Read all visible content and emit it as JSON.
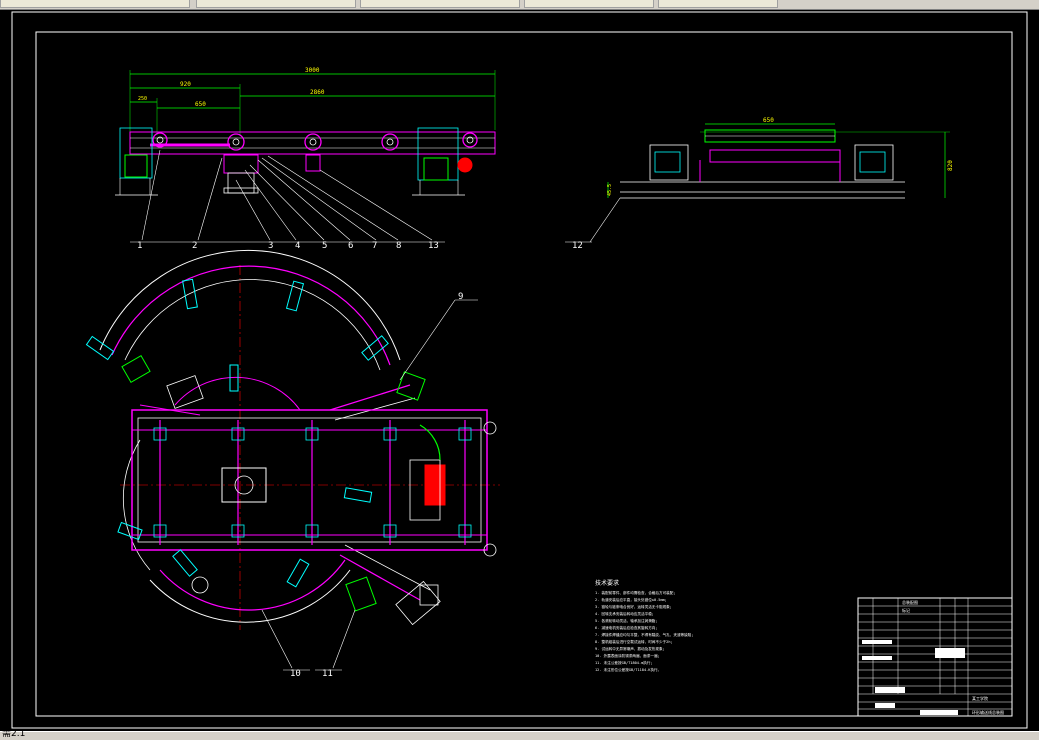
{
  "app": {
    "title": "AutoCAD drawing view"
  },
  "colors": {
    "background": "#000000",
    "frame": "#ffffff",
    "magenta": "#ff00ff",
    "green": "#00ff00",
    "cyan": "#00ffff",
    "red": "#ff0000",
    "yellow": "#ffff00",
    "white": "#ffffff"
  },
  "status": {
    "text": "需2.1"
  },
  "side_view": {
    "dimensions": [
      "3000",
      "920",
      "2860",
      "650",
      "250"
    ],
    "balloons": [
      "1",
      "2",
      "3",
      "4",
      "5",
      "6",
      "7",
      "8",
      "13"
    ]
  },
  "end_view": {
    "dimensions": [
      "650",
      "820",
      "45.5"
    ],
    "balloons": [
      "12"
    ]
  },
  "plan_view": {
    "balloons": [
      "9",
      "10",
      "11"
    ]
  },
  "notes": {
    "heading": "技术要求",
    "lines": [
      "1. 装配前零件、部件均需检查，合格后方可装配；",
      "2. 轨道安装后应平直，接头处错位≤0.5mm；",
      "3. 链轮与链条啮合良好，运转灵活无卡阻现象；",
      "4. 回转支承安装后转动应灵活平稳；",
      "5. 各滚轮转动灵活，轴承加注润滑脂；",
      "6. 减速电机安装后应检查其旋转方向；",
      "7. 焊接件焊缝应均匀平整，不得有裂纹、气孔、夹渣等缺陷；",
      "8. 整机组装后进行空载试运转，时间不少于2h；",
      "9. 试运转中无异常噪声、振动及发热现象；",
      "10. 外露表面涂防锈漆两遍，面漆一遍；",
      "11. 未注公差按GB/T1804-m执行；",
      "12. 未注形位公差按GB/T1184-K执行。"
    ]
  },
  "title_block": {
    "label1": "总装配图",
    "label2": "标记",
    "school": "某工学院",
    "drawing": "环形输送线总装图",
    "sheet": "A0"
  }
}
